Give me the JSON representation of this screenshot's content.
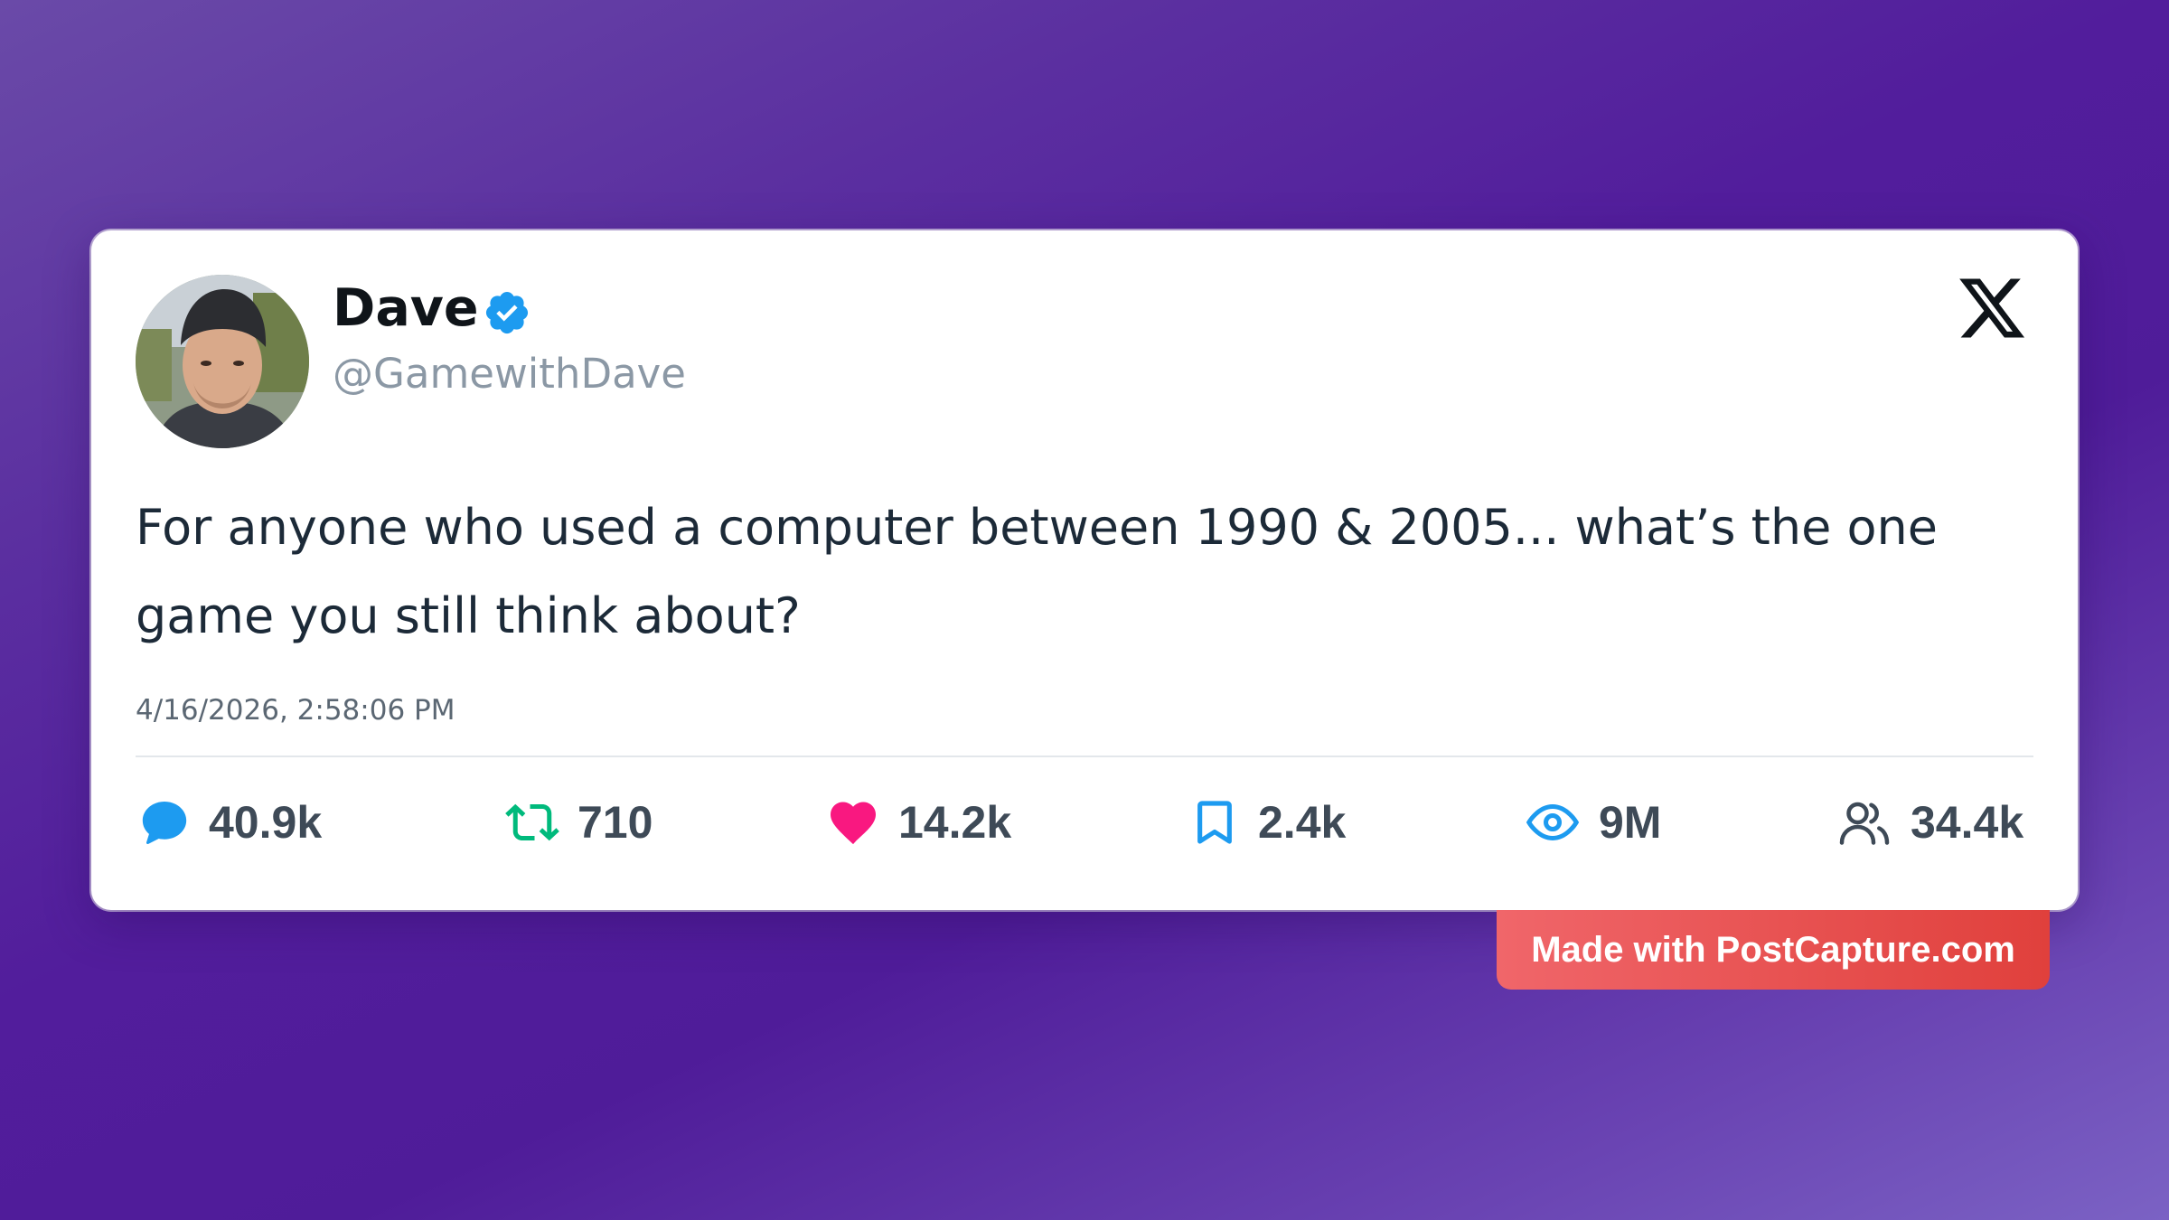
{
  "post": {
    "author": {
      "display_name": "Dave",
      "handle": "@GamewithDave",
      "verified": true
    },
    "text": "For anyone who used a computer between 1990 & 2005... what’s the one game you still think about?",
    "timestamp": "4/16/2026, 2:58:06 PM",
    "stats": {
      "replies": "40.9k",
      "reposts": "710",
      "likes": "14.2k",
      "bookmarks": "2.4k",
      "views": "9M",
      "followers": "34.4k"
    },
    "platform_icon": "x-logo-icon"
  },
  "watermark": {
    "label": "Made with PostCapture.com"
  },
  "colors": {
    "background_start": "#6a4aa8",
    "background_mid": "#521d9c",
    "background_end": "#7b62c4",
    "verified_blue": "#1d9bf0",
    "reply_blue": "#1d9bf0",
    "repost_green": "#00ba7c",
    "like_pink": "#f91880",
    "watermark_red": "#e8474a"
  }
}
